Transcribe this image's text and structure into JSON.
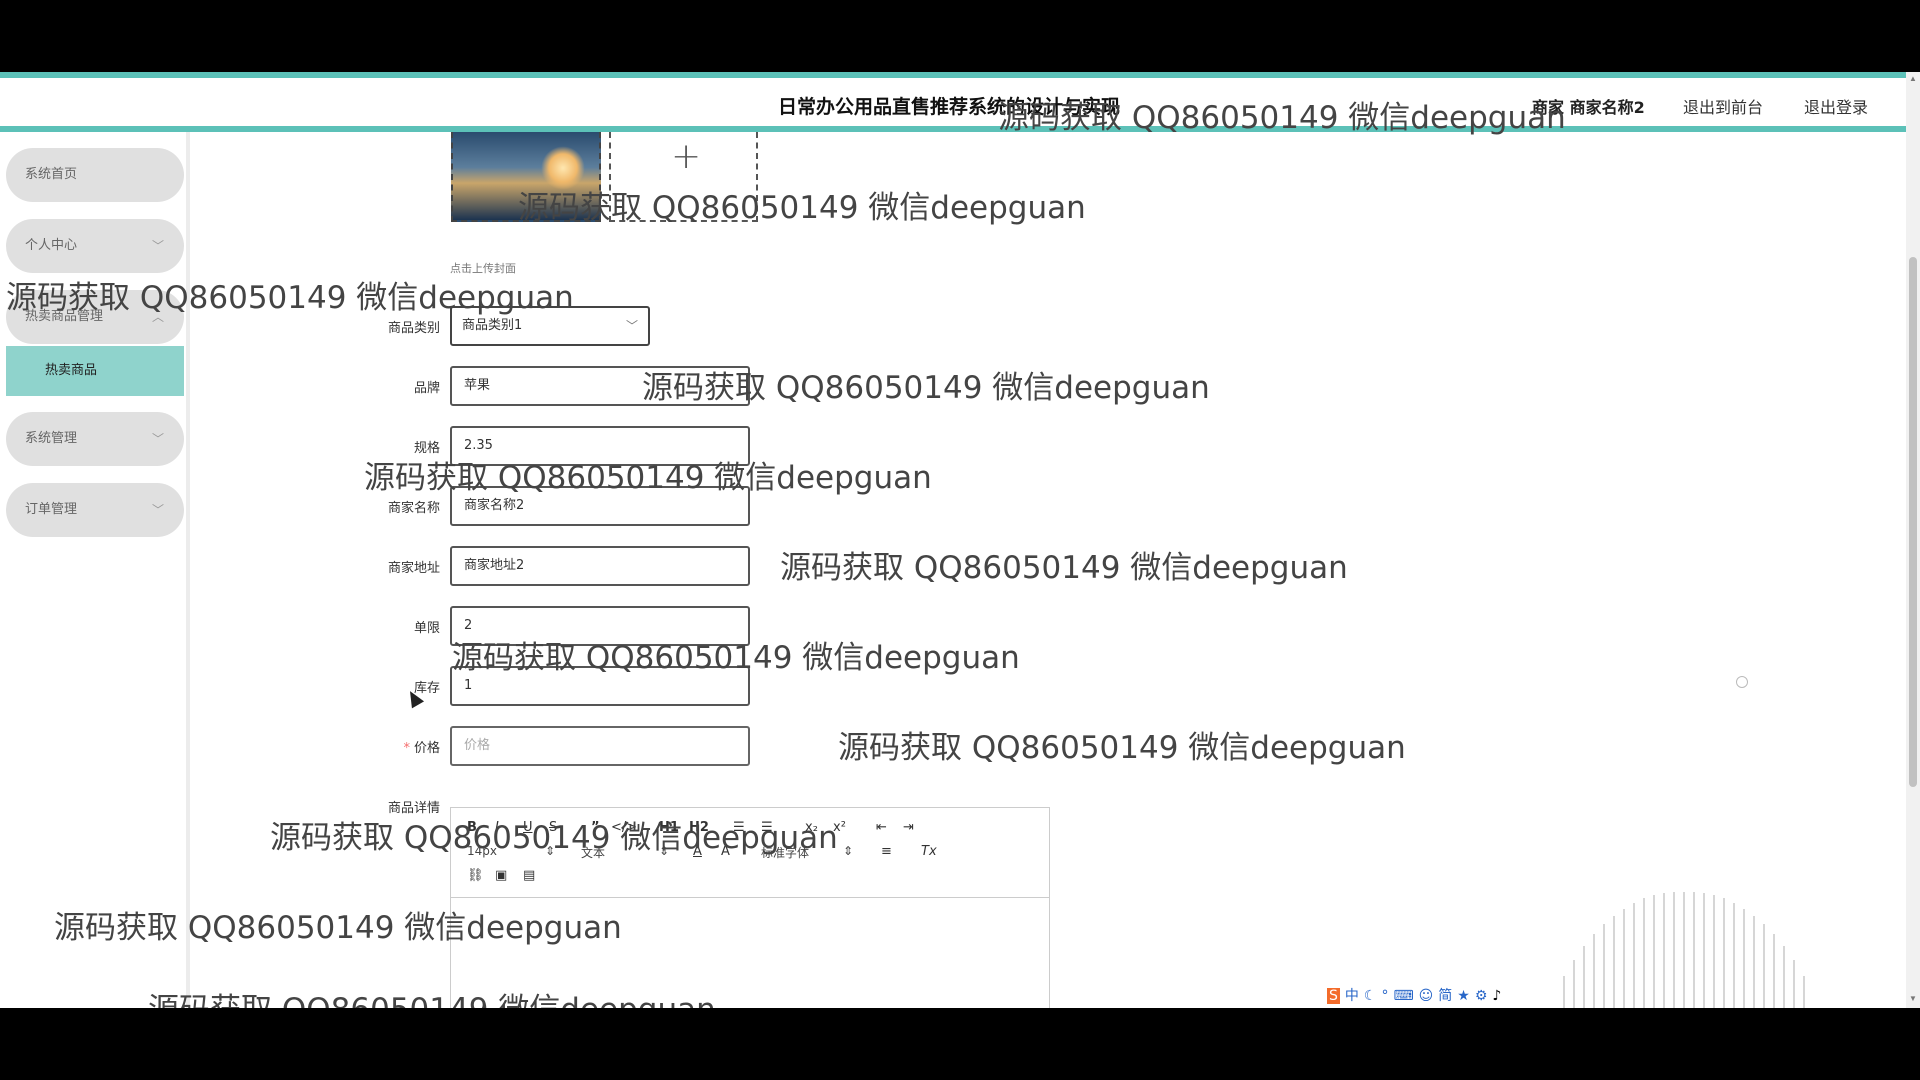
{
  "header": {
    "title": "日常办公用品直售推荐系统的设计与实现",
    "user": "商家 商家名称2",
    "link_front": "退出到前台",
    "link_logout": "退出登录"
  },
  "sidebar": {
    "items": [
      {
        "label": "系统首页"
      },
      {
        "label": "个人中心"
      },
      {
        "label": "热卖商品管理"
      },
      {
        "label": "系统管理"
      },
      {
        "label": "订单管理"
      }
    ],
    "submenu": {
      "label": "热卖商品"
    }
  },
  "form": {
    "upload_plus": "+",
    "upload_hint": "点击上传封面",
    "category": {
      "label": "商品类别",
      "value": "商品类别1"
    },
    "brand": {
      "label": "品牌",
      "value": "苹果"
    },
    "spec": {
      "label": "规格",
      "value": "2.35"
    },
    "merchant_name": {
      "label": "商家名称",
      "value": "商家名称2"
    },
    "merchant_address": {
      "label": "商家地址",
      "value": "商家地址2"
    },
    "limit": {
      "label": "单限",
      "value": "2"
    },
    "stock": {
      "label": "库存",
      "value": "1"
    },
    "price": {
      "label": "价格",
      "placeholder": "价格",
      "required_mark": "*"
    },
    "detail": {
      "label": "商品详情"
    }
  },
  "editor": {
    "font_size": "14px",
    "text_type": "文本",
    "font_family": "标准字体",
    "buttons": [
      "B",
      "I",
      "U",
      "S",
      "”",
      "</>",
      "H1",
      "H2",
      "☰",
      "☰",
      "x₂",
      "x²",
      "⇤",
      "⇥",
      "A",
      "A",
      "≡",
      "Tx"
    ]
  },
  "watermark": "源码获取 QQ86050149 微信deepguan",
  "ime": [
    "中",
    "☾",
    "°",
    "⌨",
    "☺",
    "简",
    "★",
    "⚙",
    "♪"
  ]
}
